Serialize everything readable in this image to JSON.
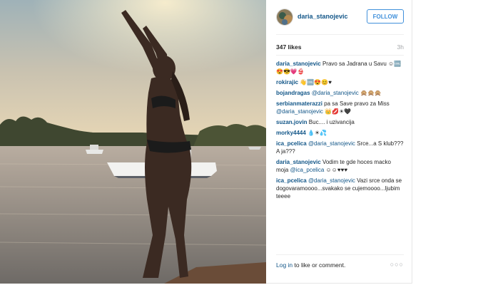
{
  "post": {
    "username": "daria_stanojevic",
    "follow_label": "FOLLOW",
    "likes": "347 likes",
    "time": "3h"
  },
  "comments": [
    {
      "user": "daria_stanojevic",
      "mention": "",
      "text": "Pravo sa Jadrana u Savu ☺🆒😍😎💗👙"
    },
    {
      "user": "rokirajic",
      "mention": "",
      "text": "👋🆒😍😊♥"
    },
    {
      "user": "bojandragas",
      "mention": "@daria_stanojevic",
      "text": "🙊🙊🙊"
    },
    {
      "user": "serbianmaterazzi",
      "mention": "@daria_stanojevic",
      "text_before": "pa sa Save pravo za Miss",
      "text": "👑💋☀🖤"
    },
    {
      "user": "suzan.jovin",
      "mention": "",
      "text": "Buc.... i uzivancija"
    },
    {
      "user": "morky4444",
      "mention": "",
      "text": "💧☀💦"
    },
    {
      "user": "ica_pcelica",
      "mention": "@daria_stanojevic",
      "text": "Srce...a S klub??? A ja???"
    },
    {
      "user": "daria_stanojevic",
      "mention": "@ica_pcelica",
      "text_before": "Vodim te gde hoces macko moja",
      "text": "☺☺♥♥♥"
    },
    {
      "user": "ica_pcelica",
      "mention": "@daria_stanojevic",
      "text": "Vazi srce onda se dogovaramoooo...svakako se cujemoooo...ljubim teeee"
    }
  ],
  "footer": {
    "login_link": "Log in",
    "login_rest": " to like or comment.",
    "more": "○○○"
  },
  "colors": {
    "link": "#125688",
    "follow": "#4090db",
    "muted": "#a5a7aa"
  }
}
